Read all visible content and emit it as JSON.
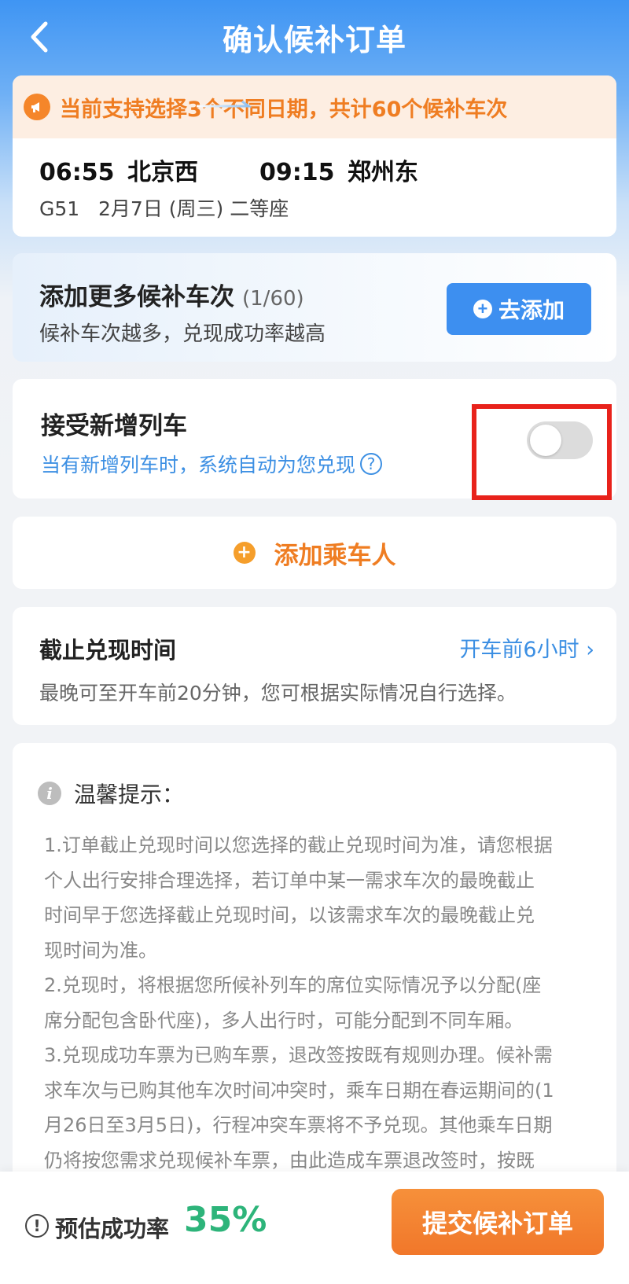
{
  "header": {
    "title": "确认候补订单"
  },
  "trip": {
    "notice": "当前支持选择3个不同日期，共计60个候补车次",
    "depart_time": "06:55",
    "depart_station": "北京西",
    "arrive_time": "09:15",
    "arrive_station": "郑州东",
    "details": "G51   2月7日 (周三) 二等座"
  },
  "add_train": {
    "title": "添加更多候补车次",
    "count": "(1/60)",
    "subtitle": "候补车次越多，兑现成功率越高",
    "button_label": "去添加"
  },
  "accept_new": {
    "title": "接受新增列车",
    "subtitle": "当有新增列车时，系统自动为您兑现",
    "toggle_on": false
  },
  "passenger": {
    "label": "添加乘车人"
  },
  "deadline": {
    "title": "截止兑现时间",
    "value": "开车前6小时 ›",
    "subtitle": "最晚可至开车前20分钟，您可根据实际情况自行选择。"
  },
  "tips": {
    "title": "温馨提示：",
    "lines": [
      "1.订单截止兑现时间以您选择的截止兑现时间为准，请您根据",
      "个人出行安排合理选择，若订单中某一需求车次的最晚截止",
      "时间早于您选择截止兑现时间，以该需求车次的最晚截止兑",
      "现时间为准。",
      "2.兑现时，将根据您所候补列车的席位实际情况予以分配(座",
      "席分配包含卧代座)，多人出行时，可能分配到不同车厢。",
      "3.兑现成功车票为已购车票，退改签按既有规则办理。候补需",
      "求车次与已购其他车次时间冲突时，乘车日期在春运期间的(1",
      "月26日至3月5日)，行程冲突车票将不予兑现。其他乘车日期",
      "仍将按您需求兑现候补车票，由此造成车票退改签时，按既"
    ]
  },
  "bottom": {
    "rate_label": "预估成功率",
    "rate_value": "35%",
    "submit_label": "提交候补订单"
  }
}
